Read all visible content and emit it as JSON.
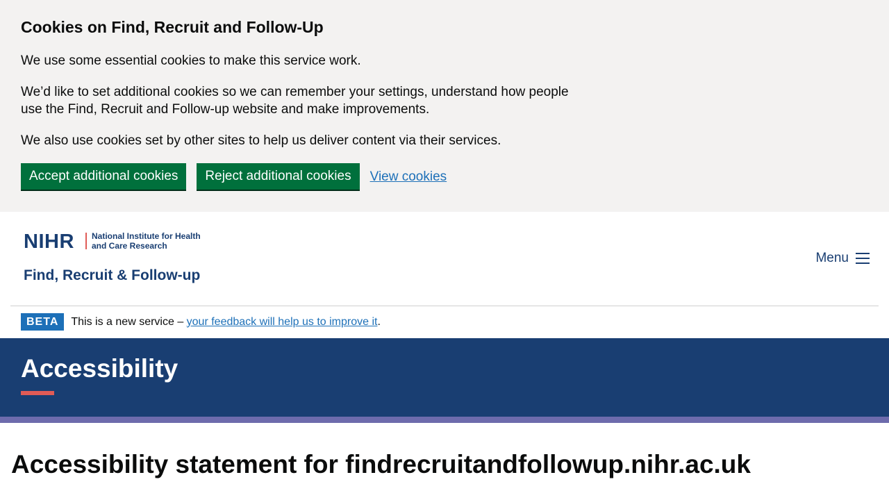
{
  "cookie_banner": {
    "title": "Cookies on Find, Recruit and Follow-Up",
    "paragraph_1": "We use some essential cookies to make this service work.",
    "paragraph_2": "We’d like to set additional cookies so we can remember your settings, understand how people use the Find, Recruit and Follow-up website and make improvements.",
    "paragraph_3": "We also use cookies set by other sites to help us deliver content via their services.",
    "accept_label": "Accept additional cookies",
    "reject_label": "Reject additional cookies",
    "view_label": "View cookies"
  },
  "header": {
    "logo_nihr": "NIHR",
    "logo_org": "National Institute for Health and Care Research",
    "service_name": "Find, Recruit & Follow-up",
    "menu_label": "Menu"
  },
  "beta_banner": {
    "tag": "BETA",
    "text_prefix": "This is a new service – ",
    "link_text": "your feedback will help us to improve it",
    "text_suffix": "."
  },
  "hero": {
    "title": "Accessibility"
  },
  "main": {
    "heading": "Accessibility statement for findrecruitandfollowup.nihr.ac.uk"
  },
  "colors": {
    "banner_bg": "#f3f2f1",
    "button_green": "#00703c",
    "link_blue": "#1d70b8",
    "brand_navy": "#193e72",
    "accent_red": "#e05b56",
    "stripe_purple": "#6d6bac"
  }
}
